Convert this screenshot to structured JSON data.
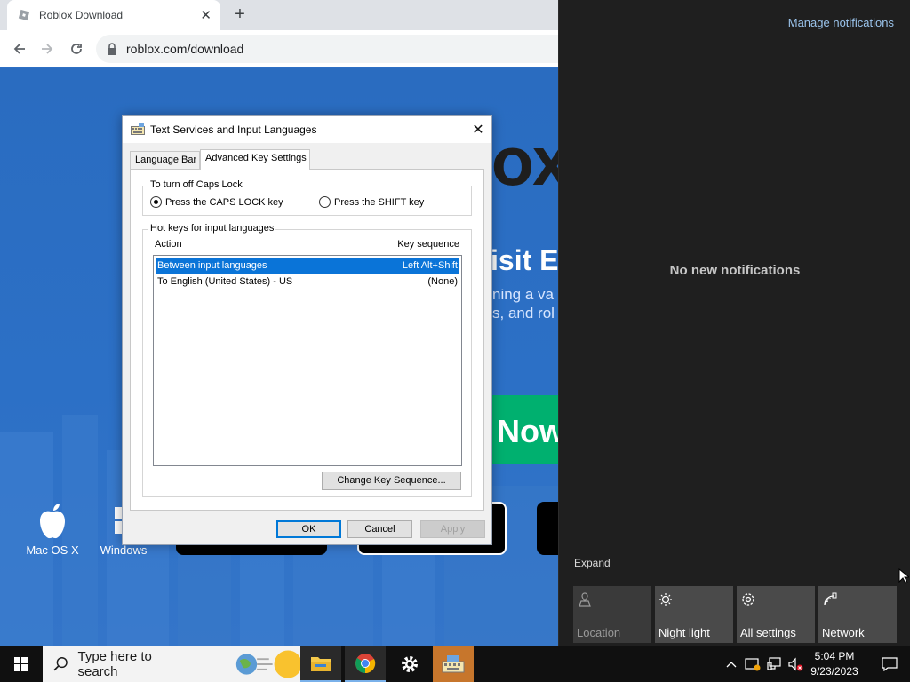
{
  "browser": {
    "tab_title": "Roblox Download",
    "tab_close": "✕",
    "new_tab": "+",
    "url": "roblox.com/download"
  },
  "page": {
    "logo_fragment": "OX",
    "heading_fragment": "isit E",
    "sub_line1": "ning a va",
    "sub_line2": "s, and rol",
    "download_fragment": "Now",
    "os_mac": "Mac OS X",
    "os_windows": "Windows"
  },
  "dialog": {
    "title": "Text Services and Input Languages",
    "close": "✕",
    "tabs": [
      "Language Bar",
      "Advanced Key Settings"
    ],
    "caps_group": {
      "legend": "To turn off Caps Lock",
      "options": [
        "Press the CAPS LOCK key",
        "Press the SHIFT key"
      ],
      "selected_index": 0
    },
    "hotkeys_group": {
      "legend": "Hot keys for input languages",
      "col_action": "Action",
      "col_sequence": "Key sequence",
      "rows": [
        {
          "action": "Between input languages",
          "sequence": "Left Alt+Shift",
          "selected": true
        },
        {
          "action": "To English (United States) - US",
          "sequence": "(None)",
          "selected": false
        }
      ],
      "change_button": "Change Key Sequence..."
    },
    "buttons": {
      "ok": "OK",
      "cancel": "Cancel",
      "apply": "Apply"
    }
  },
  "action_center": {
    "manage": "Manage notifications",
    "empty": "No new notifications",
    "expand": "Expand",
    "quick_actions": [
      {
        "label": "Location",
        "icon": "location-icon",
        "enabled": false
      },
      {
        "label": "Night light",
        "icon": "night-light-icon",
        "enabled": true
      },
      {
        "label": "All settings",
        "icon": "gear-icon",
        "enabled": true
      },
      {
        "label": "Network",
        "icon": "network-icon",
        "enabled": true
      }
    ]
  },
  "taskbar": {
    "search_placeholder": "Type here to search",
    "time": "5:04 PM",
    "date": "9/23/2023"
  },
  "colors": {
    "accent": "#0078d7",
    "selection": "#0a74d8",
    "link": "#9bc4ec",
    "page_blue": "#2d6fc4",
    "download_green": "#00b06f"
  }
}
